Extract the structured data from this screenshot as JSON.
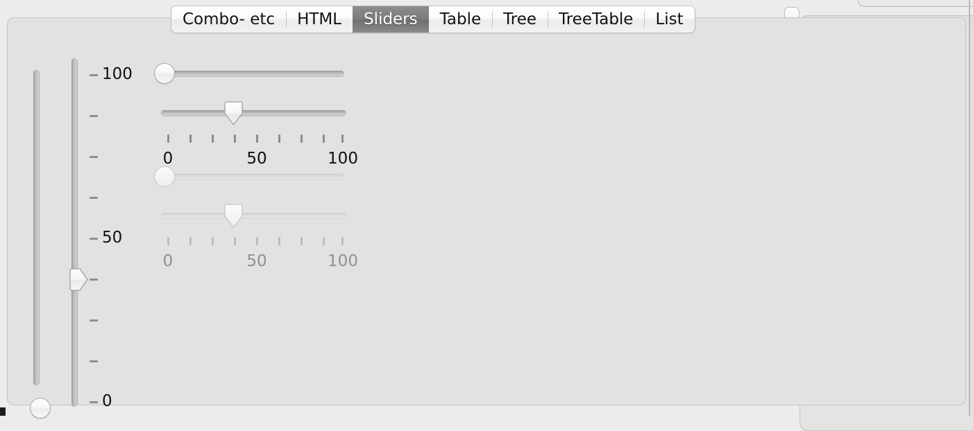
{
  "window": {
    "panel_background": "#e2e2e2",
    "desktop_background": "#ececec"
  },
  "tabs": {
    "selected": "Sliders",
    "items": [
      {
        "label": "Combo- etc",
        "selected": false
      },
      {
        "label": "HTML",
        "selected": false
      },
      {
        "label": "Sliders",
        "selected": true
      },
      {
        "label": "Table",
        "selected": false
      },
      {
        "label": "Tree",
        "selected": false
      },
      {
        "label": "TreeTable",
        "selected": false
      },
      {
        "label": "List",
        "selected": false
      }
    ]
  },
  "sliders": {
    "vertical": [
      {
        "name": "vertical-slider-plain",
        "orientation": "vertical",
        "value": 0,
        "min": 0,
        "max": 100,
        "thumb": "round",
        "ticks": false,
        "labels": false,
        "enabled": true
      },
      {
        "name": "vertical-slider-ticks",
        "orientation": "vertical",
        "value": 33,
        "min": 0,
        "max": 100,
        "thumb": "pointer-right",
        "ticks": true,
        "labels": true,
        "enabled": true,
        "tick_values": [
          0,
          12.5,
          25,
          37.5,
          50,
          62.5,
          75,
          87.5,
          100
        ],
        "labeled_ticks": [
          {
            "value": 100,
            "text": "100"
          },
          {
            "value": 50,
            "text": "50"
          },
          {
            "value": 0,
            "text": "0"
          }
        ]
      }
    ],
    "horizontal": [
      {
        "name": "horizontal-slider-plain",
        "orientation": "horizontal",
        "value": 0,
        "min": 0,
        "max": 100,
        "thumb": "round",
        "ticks": false,
        "labels": false,
        "enabled": true
      },
      {
        "name": "horizontal-slider-ticks",
        "orientation": "horizontal",
        "value": 38,
        "min": 0,
        "max": 100,
        "thumb": "pointer-down",
        "ticks": true,
        "labels": true,
        "enabled": true,
        "tick_values": [
          0,
          12.5,
          25,
          37.5,
          50,
          62.5,
          75,
          87.5,
          100
        ],
        "labels_text": [
          "0",
          "50",
          "100"
        ]
      },
      {
        "name": "horizontal-slider-plain-disabled",
        "orientation": "horizontal",
        "value": 0,
        "min": 0,
        "max": 100,
        "thumb": "round",
        "ticks": false,
        "labels": false,
        "enabled": false
      },
      {
        "name": "horizontal-slider-ticks-disabled",
        "orientation": "horizontal",
        "value": 38,
        "min": 0,
        "max": 100,
        "thumb": "pointer-down",
        "ticks": true,
        "labels": true,
        "enabled": false,
        "tick_values": [
          0,
          12.5,
          25,
          37.5,
          50,
          62.5,
          75,
          87.5,
          100
        ],
        "labels_text": [
          "0",
          "50",
          "100"
        ]
      }
    ]
  },
  "colors": {
    "tab_selected_text": "#ffffff",
    "tab_text": "#121212",
    "tick_enabled": "#8d8d8d",
    "tick_disabled": "#bdbdbd",
    "label_enabled": "#101010",
    "label_disabled": "#909090"
  }
}
